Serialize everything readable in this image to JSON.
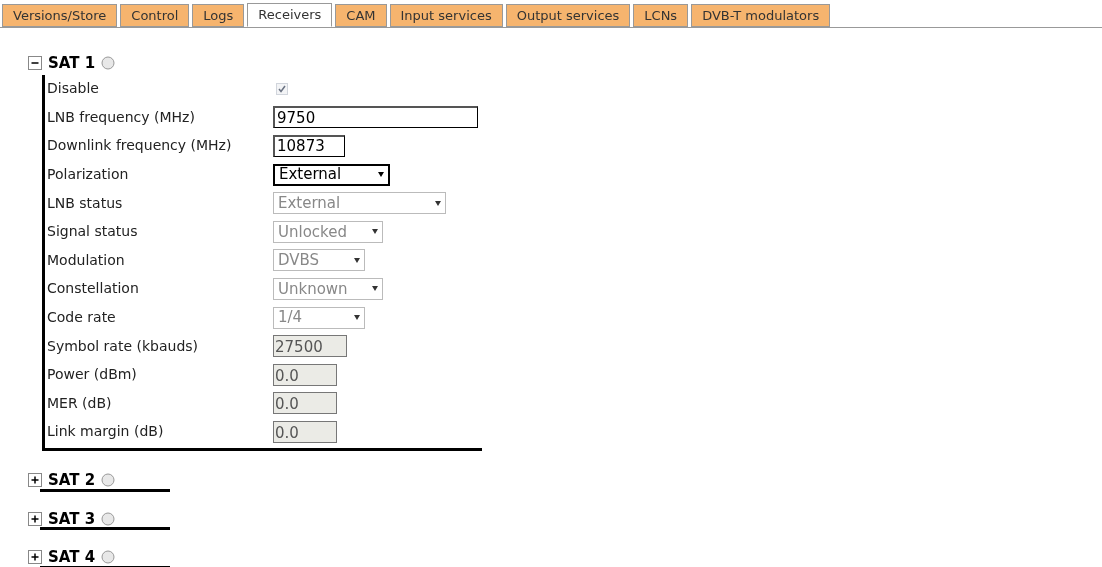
{
  "tabs": [
    {
      "label": "Versions/Store",
      "selected": false
    },
    {
      "label": "Control",
      "selected": false
    },
    {
      "label": "Logs",
      "selected": false
    },
    {
      "label": "Receivers",
      "selected": true
    },
    {
      "label": "CAM",
      "selected": false
    },
    {
      "label": "Input services",
      "selected": false
    },
    {
      "label": "Output services",
      "selected": false
    },
    {
      "label": "LCNs",
      "selected": false
    },
    {
      "label": "DVB-T modulators",
      "selected": false
    }
  ],
  "receivers": [
    {
      "title": "SAT 1",
      "expanded": true,
      "fields": [
        {
          "label": "Disable",
          "kind": "checkbox",
          "checked": true,
          "disabled": true
        },
        {
          "label": "LNB frequency (MHz)",
          "kind": "text",
          "value": "9750"
        },
        {
          "label": "Downlink frequency (MHz)",
          "kind": "text",
          "value": "10873"
        },
        {
          "label": "Polarization",
          "kind": "select",
          "value": "External",
          "disabled": false
        },
        {
          "label": "LNB status",
          "kind": "select",
          "value": "External",
          "disabled": true
        },
        {
          "label": "Signal status",
          "kind": "select",
          "value": "Unlocked",
          "disabled": true
        },
        {
          "label": "Modulation",
          "kind": "select",
          "value": "DVBS",
          "disabled": true
        },
        {
          "label": "Constellation",
          "kind": "select",
          "value": "Unknown",
          "disabled": true
        },
        {
          "label": "Code rate",
          "kind": "select",
          "value": "1/4",
          "disabled": true
        },
        {
          "label": "Symbol rate (kbauds)",
          "kind": "readonly",
          "value": "27500"
        },
        {
          "label": "Power (dBm)",
          "kind": "readonly",
          "value": "0.0"
        },
        {
          "label": "MER (dB)",
          "kind": "readonly",
          "value": "0.0"
        },
        {
          "label": "Link margin (dB)",
          "kind": "readonly",
          "value": "0.0"
        }
      ]
    },
    {
      "title": "SAT 2",
      "expanded": false
    },
    {
      "title": "SAT 3",
      "expanded": false
    },
    {
      "title": "SAT 4",
      "expanded": false
    }
  ]
}
